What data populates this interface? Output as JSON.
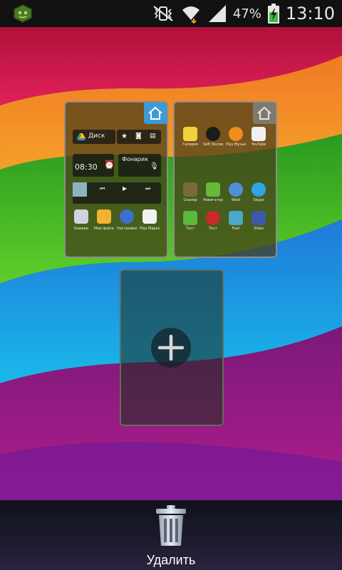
{
  "status_bar": {
    "battery_percent": "47%",
    "time": "13:10",
    "icons": [
      "app-notification-icon",
      "mute-vibrate-icon",
      "wifi-icon",
      "signal-icon",
      "battery-charging-icon"
    ]
  },
  "pages": [
    {
      "is_home": true,
      "widgets": {
        "drive_label": "Диск",
        "clock_time": "08:30",
        "flashlight_label": "Фонарик"
      },
      "apps": [
        "Камера",
        "Мои файлы",
        "Настройки",
        "Play Маркет"
      ]
    },
    {
      "is_home": false,
      "apps": [
        "Галерея",
        "Soft Эксперт",
        "Play Музыка",
        "YouTube",
        "Сканер",
        "Навигатор",
        "Weld",
        "Skype",
        "Тест",
        "Тест",
        "Fuel",
        "Video"
      ]
    }
  ],
  "add_page_icon": "plus-icon",
  "delete": {
    "label": "Удалить",
    "icon": "trash-icon"
  },
  "colors": {
    "home_badge_active": "#3a9bd7",
    "home_badge_inactive": "#7d7a6e"
  }
}
